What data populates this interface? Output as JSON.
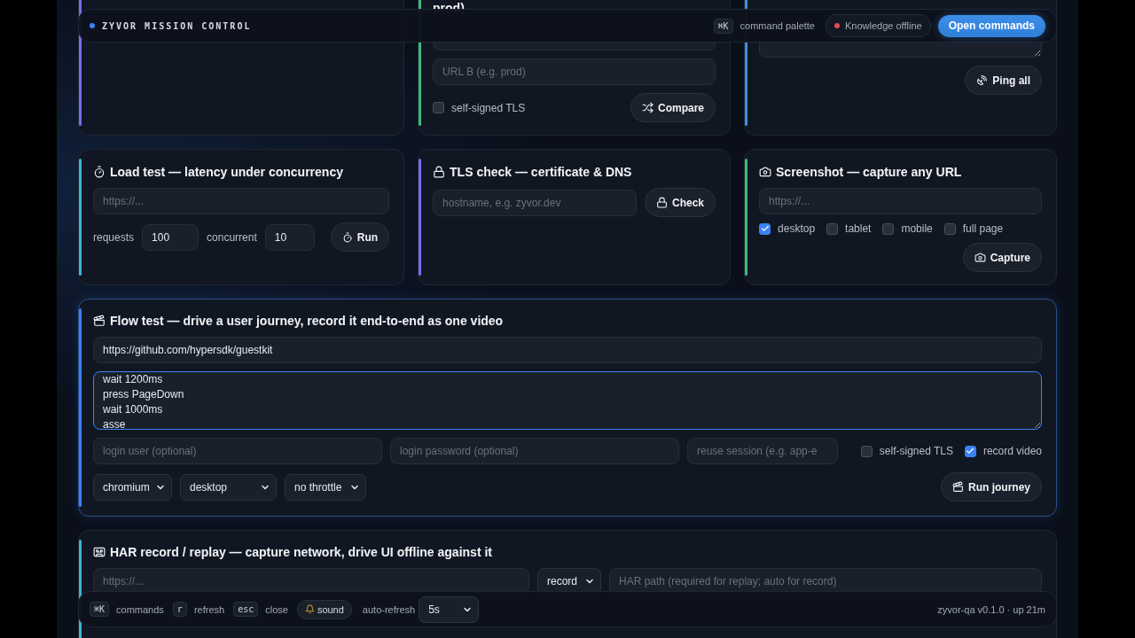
{
  "header": {
    "title": "ZYVOR MISSION CONTROL",
    "shortcut": "⌘K",
    "shortcut_label": "command palette",
    "status": {
      "label": "Knowledge offline",
      "color": "#e5484d"
    },
    "button": "Open commands"
  },
  "cards": [
    {
      "kind": "blank",
      "color": "#7c6cf0"
    },
    {
      "kind": "compare",
      "color": "#3fb97a",
      "title": "prod)",
      "placeholder": "URL B (e.g. prod)",
      "checkbox": {
        "label": "self-signed TLS",
        "checked": false
      },
      "button": "Compare"
    },
    {
      "kind": "ping",
      "color": "#3b8ee8",
      "button": "Ping all"
    },
    {
      "kind": "load",
      "color": "#3bb8d0",
      "title": "Load test — latency under concurrency",
      "placeholder": "https://...",
      "requests_label": "requests",
      "requests": "100",
      "concurrent_label": "concurrent",
      "concurrent": "10",
      "button": "Run"
    },
    {
      "kind": "tls",
      "color": "#7c6cf0",
      "title": "TLS check — certificate & DNS",
      "placeholder": "hostname, e.g. zyvor.dev",
      "button": "Check"
    },
    {
      "kind": "screenshot",
      "color": "#3fb97a",
      "title": "Screenshot — capture any URL",
      "placeholder": "https://...",
      "options": [
        {
          "label": "desktop",
          "checked": true
        },
        {
          "label": "tablet",
          "checked": false
        },
        {
          "label": "mobile",
          "checked": false
        },
        {
          "label": "full page",
          "checked": false
        }
      ],
      "button": "Capture"
    }
  ],
  "flow": {
    "color": "#3b82f6",
    "title": "Flow test — drive a user journey, record it end-to-end as one video",
    "url": "https://github.com/hypersdk/guestkit",
    "script": "wait 1200ms\npress PageDown\nwait 1000ms\nasse",
    "fields": [
      {
        "placeholder": "login user (optional)"
      },
      {
        "placeholder": "login password (optional)"
      },
      {
        "placeholder": "reuse session (e.g. app-e"
      }
    ],
    "checkboxes": [
      {
        "label": "self-signed TLS",
        "checked": false
      },
      {
        "label": "record video",
        "checked": true
      }
    ],
    "selects": [
      "chromium",
      "desktop",
      "no throttle"
    ],
    "button": "Run journey"
  },
  "har": {
    "color": "#3bb8d0",
    "title": "HAR record / replay — capture network, drive UI offline against it",
    "placeholder": "https://...",
    "mode": "record",
    "path_placeholder": "HAR path (required for replay; auto for record)"
  },
  "footer": {
    "keys": [
      {
        "key": "⌘K",
        "label": "commands"
      },
      {
        "key": "r",
        "label": "refresh"
      },
      {
        "key": "esc",
        "label": "close"
      }
    ],
    "sound": "sound",
    "auto_refresh_label": "auto-refresh",
    "auto_refresh": "5s",
    "version": "zyvor-qa v0.1.0 · up 21m"
  }
}
